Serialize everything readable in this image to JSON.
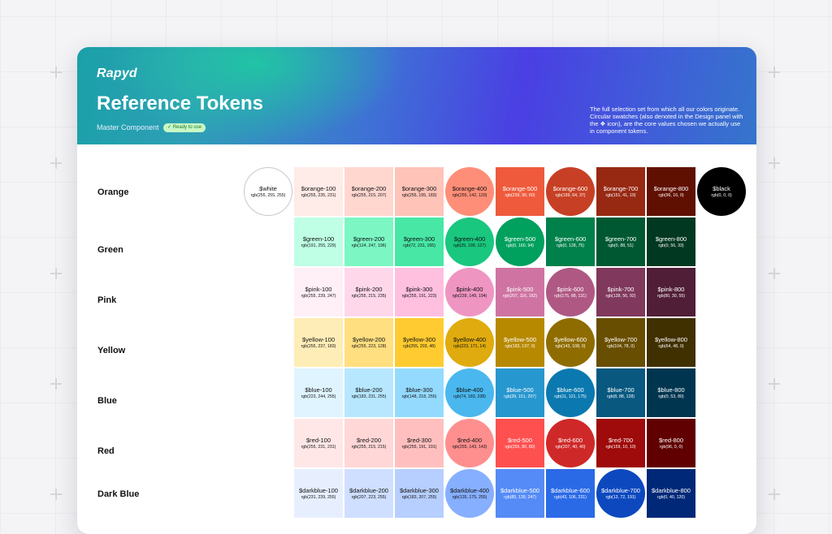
{
  "header": {
    "brand": "Rapyd",
    "title": "Reference Tokens",
    "subtitle": "Master Component",
    "badge": "✓ Ready to use",
    "description": "The full selection set from which all our colors originate. Circular swatches (also denoted in the Design panel with the ❖ icon), are the core values chosen we actually use in component tokens."
  },
  "special": {
    "white": {
      "name": "$white",
      "rgb": "rgb(255, 255, 255)",
      "hex": "#ffffff"
    },
    "black": {
      "name": "$black",
      "rgb": "rgb(0, 0, 0)",
      "hex": "#000000"
    }
  },
  "rows": [
    {
      "label": "Orange",
      "swatches": [
        {
          "name": "$orange-100",
          "rgb": "rgb(255, 235, 231)",
          "hex": "#ffebe7",
          "circle": false,
          "text": "dark"
        },
        {
          "name": "$orange-200",
          "rgb": "rgb(255, 215, 207)",
          "hex": "#ffd7cf",
          "circle": false,
          "text": "dark"
        },
        {
          "name": "$orange-300",
          "rgb": "rgb(255, 195, 183)",
          "hex": "#ffc3b7",
          "circle": false,
          "text": "dark"
        },
        {
          "name": "$orange-400",
          "rgb": "rgb(255, 142, 120)",
          "hex": "#ff8e78",
          "circle": true,
          "text": "dark"
        },
        {
          "name": "$orange-500",
          "rgb": "rgb(239, 90, 60)",
          "hex": "#ef5a3c",
          "circle": false,
          "text": "light"
        },
        {
          "name": "$orange-600",
          "rgb": "rgb(199, 64, 37)",
          "hex": "#c74025",
          "circle": true,
          "text": "light"
        },
        {
          "name": "$orange-700",
          "rgb": "rgb(151, 41, 19)",
          "hex": "#972913",
          "circle": false,
          "text": "light"
        },
        {
          "name": "$orange-800",
          "rgb": "rgb(96, 16, 0)",
          "hex": "#601000",
          "circle": false,
          "text": "light"
        }
      ]
    },
    {
      "label": "Green",
      "swatches": [
        {
          "name": "$green-100",
          "rgb": "rgb(191, 255, 229)",
          "hex": "#bfffe5",
          "circle": false,
          "text": "dark"
        },
        {
          "name": "$green-200",
          "rgb": "rgb(124, 247, 196)",
          "hex": "#7cf7c4",
          "circle": false,
          "text": "dark"
        },
        {
          "name": "$green-300",
          "rgb": "rgb(72, 231, 165)",
          "hex": "#48e7a5",
          "circle": false,
          "text": "dark"
        },
        {
          "name": "$green-400",
          "rgb": "rgb(25, 199, 127)",
          "hex": "#19c77f",
          "circle": true,
          "text": "dark"
        },
        {
          "name": "$green-500",
          "rgb": "rgb(0, 160, 94)",
          "hex": "#00a05e",
          "circle": true,
          "text": "light"
        },
        {
          "name": "$green-600",
          "rgb": "rgb(0, 128, 75)",
          "hex": "#00804b",
          "circle": false,
          "text": "light"
        },
        {
          "name": "$green-700",
          "rgb": "rgb(0, 88, 51)",
          "hex": "#005833",
          "circle": false,
          "text": "light"
        },
        {
          "name": "$green-800",
          "rgb": "rgb(0, 56, 33)",
          "hex": "#003821",
          "circle": false,
          "text": "light"
        }
      ]
    },
    {
      "label": "Pink",
      "swatches": [
        {
          "name": "$pink-100",
          "rgb": "rgb(255, 239, 247)",
          "hex": "#ffeff7",
          "circle": false,
          "text": "dark"
        },
        {
          "name": "$pink-200",
          "rgb": "rgb(255, 215, 235)",
          "hex": "#ffd7eb",
          "circle": false,
          "text": "dark"
        },
        {
          "name": "$pink-300",
          "rgb": "rgb(255, 191, 223)",
          "hex": "#ffbfdf",
          "circle": false,
          "text": "dark"
        },
        {
          "name": "$pink-400",
          "rgb": "rgb(239, 149, 194)",
          "hex": "#ef95c2",
          "circle": true,
          "text": "dark"
        },
        {
          "name": "$pink-500",
          "rgb": "rgb(207, 116, 162)",
          "hex": "#cf74a2",
          "circle": false,
          "text": "light"
        },
        {
          "name": "$pink-600",
          "rgb": "rgb(175, 88, 131)",
          "hex": "#af5883",
          "circle": true,
          "text": "light"
        },
        {
          "name": "$pink-700",
          "rgb": "rgb(128, 56, 92)",
          "hex": "#80385c",
          "circle": false,
          "text": "light"
        },
        {
          "name": "$pink-800",
          "rgb": "rgb(80, 30, 55)",
          "hex": "#501e37",
          "circle": false,
          "text": "light"
        }
      ]
    },
    {
      "label": "Yellow",
      "swatches": [
        {
          "name": "$yellow-100",
          "rgb": "rgb(255, 237, 183)",
          "hex": "#ffedb7",
          "circle": false,
          "text": "dark"
        },
        {
          "name": "$yellow-200",
          "rgb": "rgb(255, 223, 128)",
          "hex": "#ffdf80",
          "circle": false,
          "text": "dark"
        },
        {
          "name": "$yellow-300",
          "rgb": "rgb(255, 203, 48)",
          "hex": "#ffcb30",
          "circle": false,
          "text": "dark"
        },
        {
          "name": "$yellow-400",
          "rgb": "rgb(223, 171, 14)",
          "hex": "#dfab0e",
          "circle": true,
          "text": "dark"
        },
        {
          "name": "$yellow-500",
          "rgb": "rgb(183, 137, 0)",
          "hex": "#b78900",
          "circle": false,
          "text": "light"
        },
        {
          "name": "$yellow-600",
          "rgb": "rgb(143, 108, 0)",
          "hex": "#8f6c00",
          "circle": true,
          "text": "light"
        },
        {
          "name": "$yellow-700",
          "rgb": "rgb(104, 78, 0)",
          "hex": "#684e00",
          "circle": false,
          "text": "light"
        },
        {
          "name": "$yellow-800",
          "rgb": "rgb(64, 48, 0)",
          "hex": "#403000",
          "circle": false,
          "text": "light"
        }
      ]
    },
    {
      "label": "Blue",
      "swatches": [
        {
          "name": "$blue-100",
          "rgb": "rgb(223, 244, 255)",
          "hex": "#dff4ff",
          "circle": false,
          "text": "dark"
        },
        {
          "name": "$blue-200",
          "rgb": "rgb(183, 231, 255)",
          "hex": "#b7e7ff",
          "circle": false,
          "text": "dark"
        },
        {
          "name": "$blue-300",
          "rgb": "rgb(148, 218, 255)",
          "hex": "#94daff",
          "circle": false,
          "text": "dark"
        },
        {
          "name": "$blue-400",
          "rgb": "rgb(74, 183, 238)",
          "hex": "#4ab7ee",
          "circle": true,
          "text": "dark"
        },
        {
          "name": "$blue-500",
          "rgb": "rgb(39, 151, 207)",
          "hex": "#2797cf",
          "circle": false,
          "text": "light"
        },
        {
          "name": "$blue-600",
          "rgb": "rgb(11, 121, 175)",
          "hex": "#0b79af",
          "circle": true,
          "text": "light"
        },
        {
          "name": "$blue-700",
          "rgb": "rgb(8, 88, 128)",
          "hex": "#085880",
          "circle": false,
          "text": "light"
        },
        {
          "name": "$blue-800",
          "rgb": "rgb(0, 53, 80)",
          "hex": "#003550",
          "circle": false,
          "text": "light"
        }
      ]
    },
    {
      "label": "Red",
      "swatches": [
        {
          "name": "$red-100",
          "rgb": "rgb(255, 231, 231)",
          "hex": "#ffe7e7",
          "circle": false,
          "text": "dark"
        },
        {
          "name": "$red-200",
          "rgb": "rgb(255, 215, 215)",
          "hex": "#ffd7d7",
          "circle": false,
          "text": "dark"
        },
        {
          "name": "$red-300",
          "rgb": "rgb(255, 191, 191)",
          "hex": "#ffbfbf",
          "circle": false,
          "text": "dark"
        },
        {
          "name": "$red-400",
          "rgb": "rgb(255, 143, 143)",
          "hex": "#ff8f8f",
          "circle": true,
          "text": "dark"
        },
        {
          "name": "$red-500",
          "rgb": "rgb(255, 80, 80)",
          "hex": "#ff5050",
          "circle": false,
          "text": "light"
        },
        {
          "name": "$red-600",
          "rgb": "rgb(207, 40, 40)",
          "hex": "#cf2828",
          "circle": true,
          "text": "light"
        },
        {
          "name": "$red-700",
          "rgb": "rgb(159, 10, 10)",
          "hex": "#9f0a0a",
          "circle": false,
          "text": "light"
        },
        {
          "name": "$red-800",
          "rgb": "rgb(96, 0, 0)",
          "hex": "#600000",
          "circle": false,
          "text": "light"
        }
      ]
    },
    {
      "label": "Dark Blue",
      "swatches": [
        {
          "name": "$darkblue-100",
          "rgb": "rgb(231, 239, 255)",
          "hex": "#e7efff",
          "circle": false,
          "text": "dark"
        },
        {
          "name": "$darkblue-200",
          "rgb": "rgb(207, 223, 255)",
          "hex": "#cfdfff",
          "circle": false,
          "text": "dark"
        },
        {
          "name": "$darkblue-300",
          "rgb": "rgb(183, 207, 255)",
          "hex": "#b7cfff",
          "circle": false,
          "text": "dark"
        },
        {
          "name": "$darkblue-400",
          "rgb": "rgb(135, 175, 255)",
          "hex": "#87afff",
          "circle": true,
          "text": "dark"
        },
        {
          "name": "$darkblue-500",
          "rgb": "rgb(85, 139, 247)",
          "hex": "#558bf7",
          "circle": false,
          "text": "light"
        },
        {
          "name": "$darkblue-600",
          "rgb": "rgb(43, 106, 231)",
          "hex": "#2b6ae7",
          "circle": false,
          "text": "light"
        },
        {
          "name": "$darkblue-700",
          "rgb": "rgb(13, 72, 191)",
          "hex": "#0d48bf",
          "circle": true,
          "text": "light"
        },
        {
          "name": "$darkblue-800",
          "rgb": "rgb(0, 40, 120)",
          "hex": "#002878",
          "circle": false,
          "text": "light"
        }
      ]
    }
  ]
}
